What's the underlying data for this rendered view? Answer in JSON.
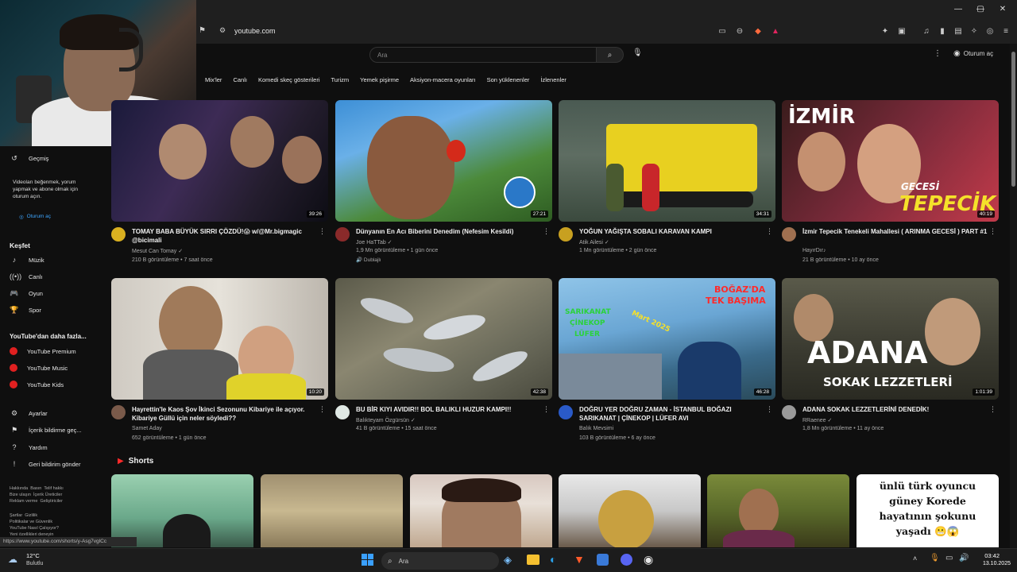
{
  "browser": {
    "url": "youtube.com",
    "window_controls": [
      "—",
      "▢",
      "✕"
    ]
  },
  "header": {
    "search_placeholder": "Ara",
    "sign_in": "Oturum aç"
  },
  "chips": [
    "Mix'ler",
    "Canlı",
    "Komedi skeç gösterileri",
    "Turizm",
    "Yemek pişirme",
    "Aksiyon-macera oyunları",
    "Son yüklenenler",
    "İzlenenler"
  ],
  "sidebar": {
    "history": "Geçmiş",
    "signin_prompt": "Videoları beğenmek, yorum yapmak ve abone olmak için oturum açın.",
    "signin_button": "Oturum aç",
    "explore_title": "Keşfet",
    "explore": [
      "Müzik",
      "Canlı",
      "Oyun",
      "Spor"
    ],
    "more_title": "YouTube'dan daha fazla...",
    "more": [
      "YouTube Premium",
      "YouTube Music",
      "YouTube Kids"
    ],
    "settings": [
      "Ayarlar",
      "İçerik bildirme geç...",
      "Yardım",
      "Geri bildirim gönder"
    ],
    "footer1": "Hakkında  Basın  Telif hakkı\nBize ulaşın  İçerik Üreticiler\nReklam verme  Geliştiriciler",
    "footer2": "Şartlar  Gizlilik\nPolitikalar ve Güvenlik\nYouTube Nasıl Çalışıyor?\nYeni özellikleri deneyin"
  },
  "videos": [
    {
      "title": "TOMAY BABA BÜYÜK SIRRI ÇÖZDÜ!😱 w/@Mr.bigmagic @bicimali",
      "channel": "Mesut Can Tomay ✓",
      "stats": "210 B görüntüleme • 7 saat önce",
      "duration": "39:26",
      "extra": ""
    },
    {
      "title": "Dünyanın En Acı Biberini Denedim (Nefesim Kesildi)",
      "channel": "Joe HaTTab ✓",
      "stats": "1,9 Mn görüntüleme • 1 gün önce",
      "duration": "27:21",
      "extra": "🔊 Dublajlı"
    },
    {
      "title": "YOĞUN YAĞIŞTA SOBALI KARAVAN KAMPI",
      "channel": "Atik Ailesi ✓",
      "stats": "1 Mn görüntüleme • 2 gün önce",
      "duration": "34:31",
      "extra": ""
    },
    {
      "title": "İzmir Tepecik Tenekeli Mahallesi ( ARINMA GECESİ ) PART #1",
      "channel": "HayırDır♪",
      "stats": "21 B görüntüleme • 10 ay önce",
      "duration": "40:19",
      "extra": ""
    },
    {
      "title": "Hayrettin'le Kaos Şov İkinci Sezonunu Kibariye ile açıyor. Kibariye Güllü için neler söyledi??",
      "channel": "Samet Aday",
      "stats": "652 görüntüleme • 1 gün önce",
      "duration": "10:20",
      "extra": ""
    },
    {
      "title": "BU BİR KIYI AVIDIR!! BOL BALIKLI HUZUR KAMPI!!",
      "channel": "Balıkteyam Özgürsün ✓",
      "stats": "41 B görüntüleme • 15 saat önce",
      "duration": "42:38",
      "extra": ""
    },
    {
      "title": "DOĞRU YER DOĞRU ZAMAN - İSTANBUL BOĞAZI SARIKANAT | ÇİNEKOP | LÜFER AVI",
      "channel": "Balık Mevsimi",
      "stats": "103 B görüntüleme • 6 ay önce",
      "duration": "46:28",
      "extra": ""
    },
    {
      "title": "ADANA SOKAK LEZZETLERİNİ DENEDİK!",
      "channel": "RRaenee ✓",
      "stats": "1,8 Mn görüntüleme • 11 ay önce",
      "duration": "1:01:39",
      "extra": ""
    }
  ],
  "thumb_text": {
    "v3_big": "İZMİR",
    "v3_sub": "GECESİ",
    "v3_main": "TEPECİK",
    "v6_a": "BOĞAZ'DA",
    "v6_b": "TEK BAŞIMA",
    "v6_c": "SARIKANAT",
    "v6_d": "ÇİNEKOP",
    "v6_e": "LÜFER",
    "v6_f": "Mart 2025",
    "v7_big": "ADANA",
    "v7_sub": "SOKAK LEZZETLERİ"
  },
  "shorts": {
    "title": "Shorts",
    "last_text": "ünlü türk oyuncu güney Korede hayatının şokunu yaşadı 😬😱"
  },
  "status_url": "https://www.youtube.com/shorts/y-Asg7vglCc",
  "taskbar": {
    "weather_temp": "12°C",
    "weather_desc": "Bulutlu",
    "search": "Ara",
    "time": "03:42",
    "date": "13.10.2025"
  }
}
